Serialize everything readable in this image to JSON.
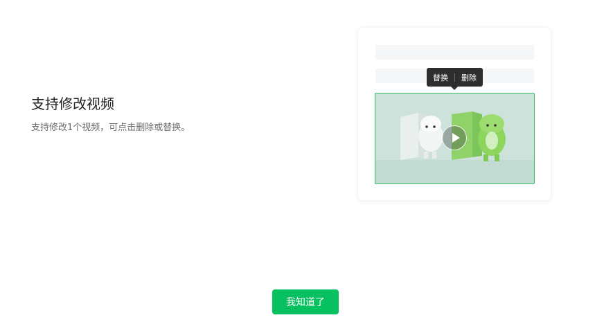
{
  "feature": {
    "title": "支持修改视频",
    "description": "支持修改1个视频，可点击删除或替换。"
  },
  "tooltip": {
    "replace_label": "替换",
    "delete_label": "删除"
  },
  "video": {
    "play_icon": "play-icon",
    "border_color": "#2fbf63"
  },
  "actions": {
    "confirm_label": "我知道了"
  },
  "colors": {
    "accent": "#07c160",
    "tooltip_bg": "#2e2e2e"
  }
}
